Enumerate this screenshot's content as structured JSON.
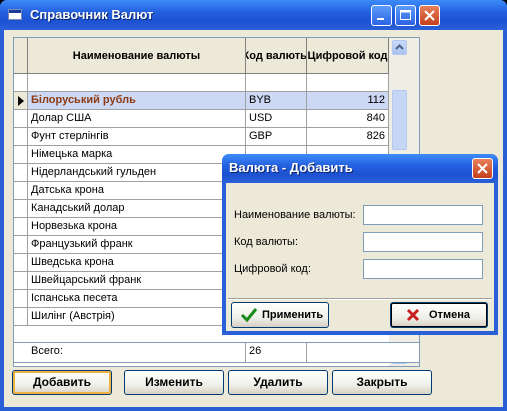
{
  "window": {
    "title": "Справочник Валют"
  },
  "grid": {
    "columns": [
      "Наименование валюты",
      "Код валюты",
      "Цифровой код"
    ],
    "rows": [
      {
        "name": "Білоруський рубль",
        "code": "BYB",
        "num": "112"
      },
      {
        "name": "Долар США",
        "code": "USD",
        "num": "840"
      },
      {
        "name": "Фунт стерлінгів",
        "code": "GBP",
        "num": "826"
      },
      {
        "name": "Німецька марка",
        "code": "",
        "num": ""
      },
      {
        "name": "Нідерландський гульден",
        "code": "",
        "num": ""
      },
      {
        "name": "Датська крона",
        "code": "",
        "num": ""
      },
      {
        "name": "Канадський долар",
        "code": "",
        "num": ""
      },
      {
        "name": "Норвезька крона",
        "code": "",
        "num": ""
      },
      {
        "name": "Французький франк",
        "code": "",
        "num": ""
      },
      {
        "name": "Шведська крона",
        "code": "",
        "num": ""
      },
      {
        "name": "Швейцарський франк",
        "code": "",
        "num": ""
      },
      {
        "name": "Іспанська песета",
        "code": "",
        "num": ""
      },
      {
        "name": "Шилінг (Австрія)",
        "code": "",
        "num": ""
      }
    ],
    "summary_label": "Всего:",
    "summary_value": "26"
  },
  "buttons": {
    "add": "Добавить",
    "edit": "Изменить",
    "delete": "Удалить",
    "close": "Закрыть"
  },
  "dialog": {
    "title": "Валюта - Добавить",
    "name_label": "Наименование валюты:",
    "code_label": "Код валюты:",
    "num_label": "Цифровой код:",
    "apply": "Применить",
    "cancel": "Отмена"
  },
  "colors": {
    "titlebar": "#2460e0",
    "selected_row": "#ccd8f4",
    "selected_text": "#8c3c14"
  }
}
